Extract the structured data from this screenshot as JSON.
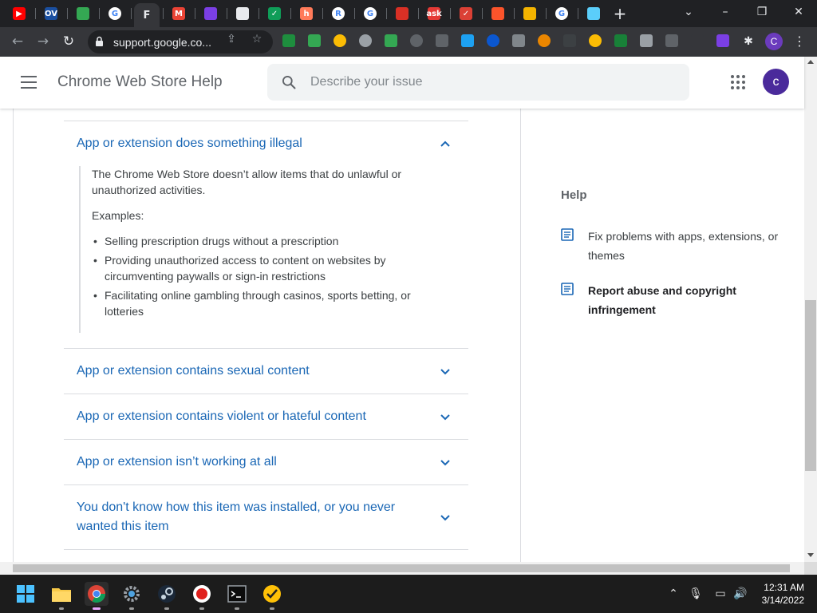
{
  "browser": {
    "url": "support.google.co...",
    "active_tab_initial": "F",
    "profile_initial": "C",
    "colors": {
      "chrome_dark": "#202124",
      "toolbar": "#35363a"
    },
    "tabs": [
      {
        "icon": "youtube-icon",
        "color": "#ff0000",
        "glyph": "▶"
      },
      {
        "icon": "ov-icon",
        "color": "#1a4fa0",
        "glyph": "OV"
      },
      {
        "icon": "messages-icon",
        "color": "#34a853",
        "glyph": ""
      },
      {
        "icon": "google-icon",
        "color": "#ffffff",
        "glyph": "G"
      },
      {
        "icon": "active-tab-icon",
        "color": "#35363a",
        "glyph": "F"
      },
      {
        "icon": "gmail-icon",
        "color": "#ea4335",
        "glyph": "M"
      },
      {
        "icon": "chat-icon",
        "color": "#7b3fe4",
        "glyph": ""
      },
      {
        "icon": "docs-icon",
        "color": "#e8eaed",
        "glyph": ""
      },
      {
        "icon": "check-icon",
        "color": "#0f9d58",
        "glyph": "✓"
      },
      {
        "icon": "hubspot-icon",
        "color": "#ff7a59",
        "glyph": "h"
      },
      {
        "icon": "r-icon",
        "color": "#ffffff",
        "glyph": "R"
      },
      {
        "icon": "google-icon",
        "color": "#ffffff",
        "glyph": "G"
      },
      {
        "icon": "store-icon",
        "color": "#d93025",
        "glyph": ""
      },
      {
        "icon": "ask-icon",
        "color": "#e53935",
        "glyph": "ask"
      },
      {
        "icon": "todoist-icon",
        "color": "#db4035",
        "glyph": "✓"
      },
      {
        "icon": "brave-icon",
        "color": "#fb542b",
        "glyph": ""
      },
      {
        "icon": "lock-icon",
        "color": "#f4b400",
        "glyph": ""
      },
      {
        "icon": "google-icon",
        "color": "#ffffff",
        "glyph": "G"
      },
      {
        "icon": "flag-icon",
        "color": "#5bcefa",
        "glyph": ""
      }
    ]
  },
  "header": {
    "title": "Chrome Web Store Help",
    "search_placeholder": "Describe your issue",
    "avatar_initial": "c"
  },
  "accordion": {
    "expanded": {
      "title": "App or extension does something illegal",
      "intro": "The Chrome Web Store doesn’t allow items that do unlawful or unauthorized activities.",
      "examples_label": "Examples:",
      "examples": [
        "Selling prescription drugs without a prescription",
        "Providing unauthorized access to content on websites by circumventing paywalls or sign-in restrictions",
        "Facilitating online gambling through casinos, sports betting, or lotteries"
      ]
    },
    "collapsed": [
      "App or extension contains sexual content",
      "App or extension contains violent or hateful content",
      "App or extension isn’t working at all",
      "You don't know how this item was installed, or you never wanted this item"
    ],
    "link_color": "#1a67b5"
  },
  "sidebar": {
    "heading": "Help",
    "links": [
      {
        "label": "Fix problems with apps, extensions, or themes",
        "icon": "article-icon",
        "bold": false
      },
      {
        "label": "Report abuse and copyright infringement",
        "icon": "article-icon",
        "bold": true
      }
    ]
  },
  "taskbar": {
    "time": "12:31 AM",
    "date": "3/14/2022",
    "apps": [
      "windows-start-icon",
      "file-explorer-icon",
      "chrome-icon",
      "settings-icon",
      "steam-icon",
      "record-icon",
      "terminal-icon",
      "norton-icon"
    ]
  }
}
